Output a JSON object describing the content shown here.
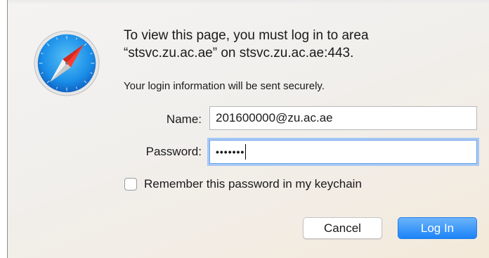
{
  "dialog": {
    "message_line1": "To view this page, you must log in to area",
    "message_line2": "“stsvc.zu.ac.ae” on stsvc.zu.ac.ae:443.",
    "secure_note": "Your login information will be sent securely.",
    "icon": "safari-compass-icon"
  },
  "form": {
    "name_label": "Name:",
    "name_value": "201600000@zu.ac.ae",
    "password_label": "Password:",
    "password_masked": "•••••••",
    "remember_label": "Remember this password in my keychain",
    "remember_checked": false
  },
  "buttons": {
    "cancel_label": "Cancel",
    "login_label": "Log In"
  },
  "colors": {
    "accent": "#1b84f8",
    "focus_ring": "#a7c8f4"
  }
}
